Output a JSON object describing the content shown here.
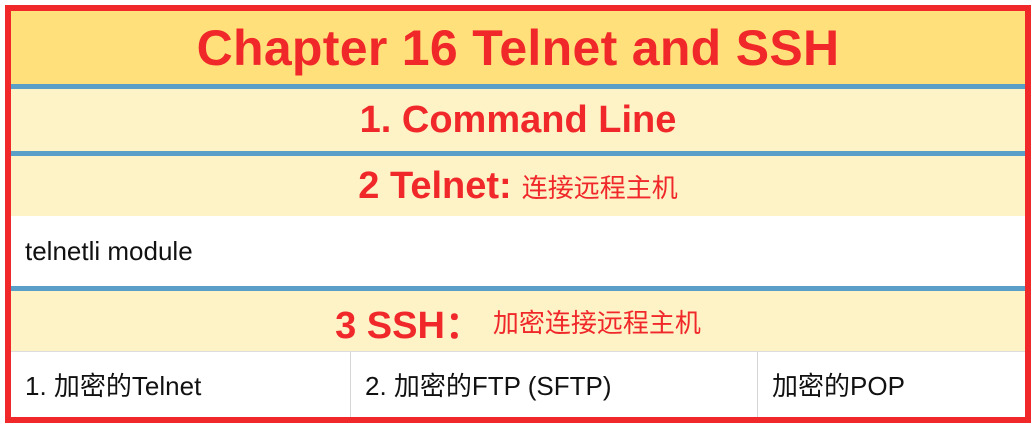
{
  "title": "Chapter 16 Telnet and SSH",
  "sections": {
    "command_line": "1. Command Line",
    "telnet": {
      "heading": "2 Telnet:",
      "subtitle": "连接远程主机"
    },
    "telnet_module": "telnetli module",
    "ssh": {
      "heading": "3 SSH：",
      "subtitle": "加密连接远程主机"
    },
    "ssh_items": [
      "1. 加密的Telnet",
      "2. 加密的FTP (SFTP)",
      "加密的POP"
    ]
  },
  "colors": {
    "border": "#f0282a",
    "title_bg": "#ffe07a",
    "section_bg": "#fef2c7",
    "separator": "#5a9fc8",
    "heading_text": "#f0282a"
  }
}
